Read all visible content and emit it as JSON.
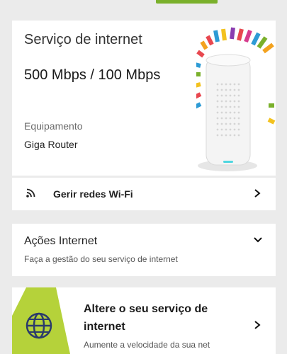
{
  "service": {
    "title": "Serviço de internet",
    "speed": "500 Mbps / 100 Mbps",
    "equipment_label": "Equipamento",
    "equipment_value": "Giga Router"
  },
  "wifi": {
    "label": "Gerir redes Wi-Fi",
    "icon": "wifi-icon"
  },
  "actions": {
    "title": "Ações Internet",
    "subtitle": "Faça a gestão do seu serviço de internet"
  },
  "change_service": {
    "title": "Altere o seu serviço de internet",
    "subtitle": "Aumente a velocidade da sua net",
    "icon": "globe-icon"
  },
  "colors": {
    "accent_green": "#7ab02b",
    "promo_green": "#b5d23a"
  }
}
